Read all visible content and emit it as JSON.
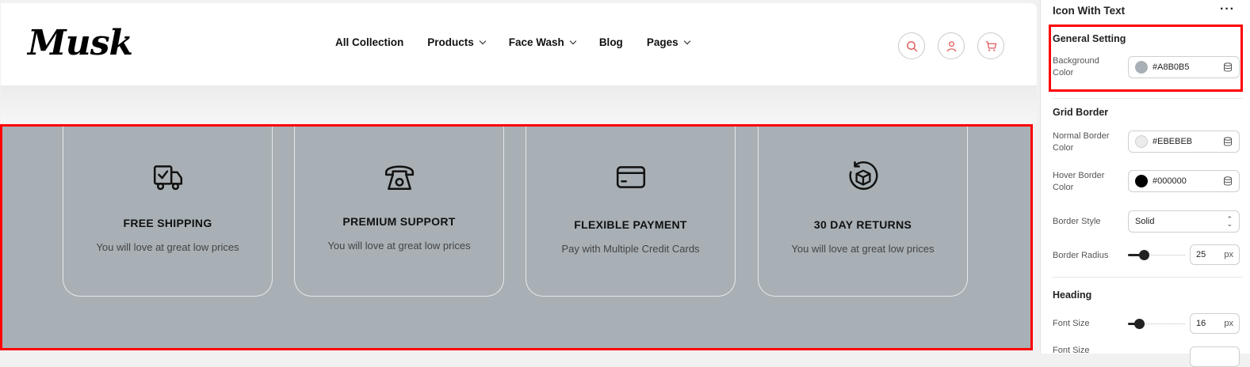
{
  "header": {
    "logo": "Musk",
    "nav": [
      {
        "label": "All Collection",
        "has_dropdown": false
      },
      {
        "label": "Products",
        "has_dropdown": true
      },
      {
        "label": "Face Wash",
        "has_dropdown": true
      },
      {
        "label": "Blog",
        "has_dropdown": false
      },
      {
        "label": "Pages",
        "has_dropdown": true
      }
    ],
    "icons": [
      "search-icon",
      "user-icon",
      "cart-icon"
    ],
    "accent_color": "#e05a5a"
  },
  "features": {
    "background_color": "#a8b0b5",
    "cards": [
      {
        "icon": "truck-icon",
        "title": "FREE SHIPPING",
        "subtitle": "You will love at great low prices"
      },
      {
        "icon": "telephone-icon",
        "title": "PREMIUM SUPPORT",
        "subtitle": "You will love at great low prices"
      },
      {
        "icon": "credit-card-icon",
        "title": "FLEXIBLE PAYMENT",
        "subtitle": "Pay with Multiple Credit Cards"
      },
      {
        "icon": "box-return-icon",
        "title": "30 DAY RETURNS",
        "subtitle": "You will love at great low prices"
      }
    ]
  },
  "panel": {
    "title": "Icon With Text",
    "more": "···",
    "general": {
      "title": "General Setting",
      "background_label": "Background Color",
      "background_value": "#A8B0B5",
      "background_swatch": "#a8b0b5"
    },
    "grid_border": {
      "title": "Grid Border",
      "normal_label": "Normal Border Color",
      "normal_value": "#EBEBEB",
      "normal_swatch": "#ebebeb",
      "hover_label": "Hover Border Color",
      "hover_value": "#000000",
      "hover_swatch": "#000000",
      "style_label": "Border Style",
      "style_value": "Solid",
      "radius_label": "Border Radius",
      "radius_value": "25",
      "radius_unit": "px",
      "radius_fraction": 0.28
    },
    "heading": {
      "title": "Heading",
      "font_size_label": "Font Size",
      "font_size_value": "16",
      "font_size_unit": "px",
      "font_size_fraction": 0.2,
      "next_label": "Font Size"
    }
  }
}
